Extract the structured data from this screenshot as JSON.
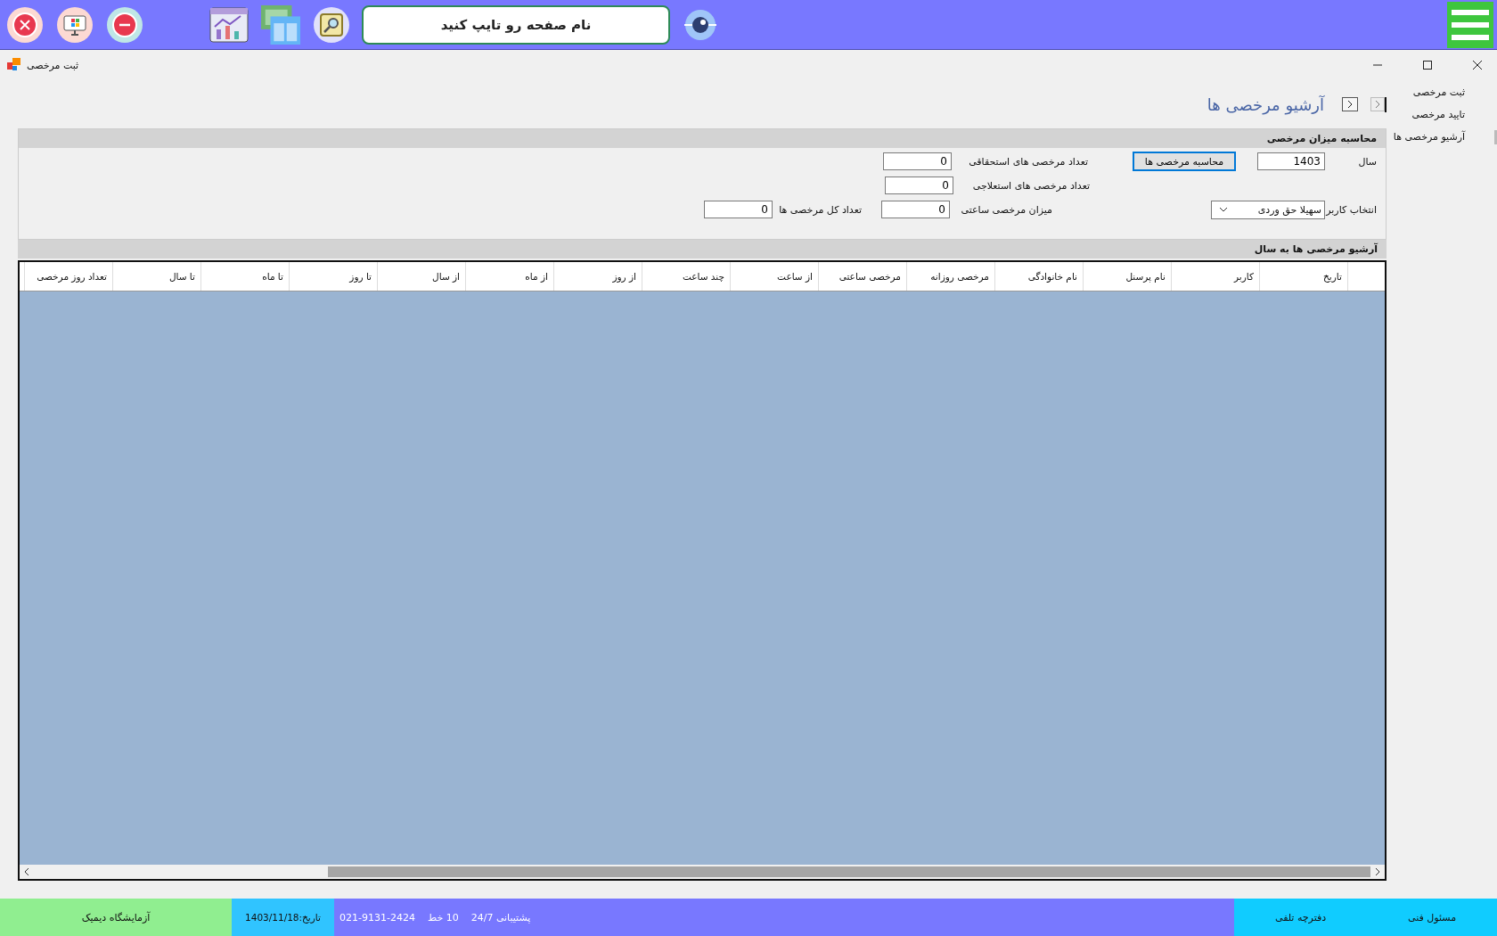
{
  "top_bar": {
    "search": {
      "placeholder": "نام صفحه رو تایپ کنید"
    }
  },
  "window": {
    "title": "ثبت مرخصی"
  },
  "sidebar": {
    "items": [
      {
        "label": "ثبت مرخصی",
        "selected": false
      },
      {
        "label": "تایید مرخصی",
        "selected": false
      },
      {
        "label": "آرشیو مرخصی ها",
        "selected": true
      }
    ]
  },
  "page_title": "آرشیو مرخصی ها",
  "calc_group": {
    "title": "محاسبه میزان مرخصی",
    "year": {
      "label": "سال",
      "value": "1403"
    },
    "calc_button": "محاسبه مرخصی ها",
    "user": {
      "label": "انتخاب کاربر",
      "value": "سهیلا حق وردی"
    },
    "entitled": {
      "label": "تعداد مرخصی های استحقاقی",
      "value": "0"
    },
    "sick": {
      "label": "تعداد مرخصی های استعلاجی",
      "value": "0"
    },
    "hourly": {
      "label": "میزان مرخصی ساعتی",
      "value": "0"
    },
    "total": {
      "label": "تعداد کل مرخصی ها",
      "value": "0"
    }
  },
  "archive": {
    "title": "آرشیو مرخصی ها به سال",
    "columns": [
      "تاریخ",
      "کاربر",
      "نام پرسنل",
      "نام خانوادگی",
      "مرخصی روزانه",
      "مرخصی ساعتی",
      "از ساعت",
      "چند ساعت",
      "از روز",
      "از ماه",
      "از سال",
      "تا روز",
      "تا ماه",
      "تا سال",
      "تعداد روز مرخصی"
    ]
  },
  "status_bar": {
    "lab": "آزمایشگاه دیمیک",
    "date": "تاریخ:1403/11/18",
    "support": [
      "پشتیبانی 24/7",
      "10 خط",
      "021-9131-2424"
    ],
    "links": [
      "مسئول فنی",
      "دفترچه تلفی"
    ]
  }
}
